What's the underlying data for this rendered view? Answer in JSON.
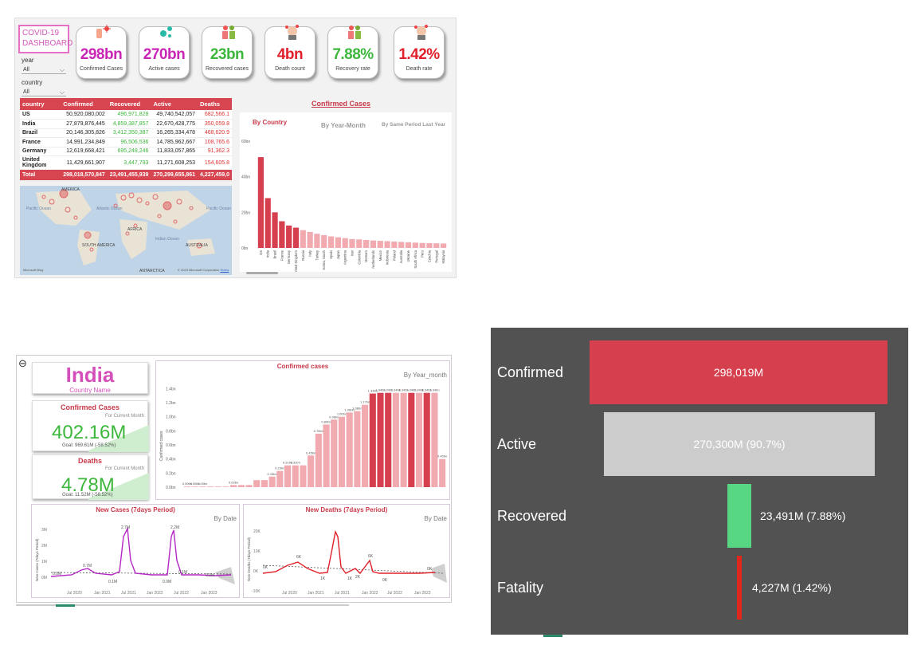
{
  "dashboard": {
    "title_line1": "COVID-19",
    "title_line2": "DASHBOARD",
    "slicers": [
      {
        "label": "year",
        "value": "All"
      },
      {
        "label": "country",
        "value": "All"
      }
    ],
    "kpis": [
      {
        "value": "298bn",
        "label": "Confirmed Cases",
        "color": "#c926b6"
      },
      {
        "value": "270bn",
        "label": "Active cases",
        "color": "#c926b6"
      },
      {
        "value": "23bn",
        "label": "Recovered cases",
        "color": "#3cb73c"
      },
      {
        "value": "4bn",
        "label": "Death count",
        "color": "#e0202a"
      },
      {
        "value": "7.88%",
        "label": "Recovery rate",
        "color": "#3cb73c"
      },
      {
        "value": "1.42%",
        "label": "Death rate",
        "color": "#e0202a"
      }
    ],
    "table": {
      "headers": [
        "country",
        "Confirmed",
        "Recovered",
        "Active",
        "Deaths"
      ],
      "rows": [
        [
          "US",
          "50,920,080,002",
          "496,971,828",
          "49,740,542,057",
          "682,566.1"
        ],
        [
          "India",
          "27,879,876,445",
          "4,859,387,857",
          "22,670,428,775",
          "350,059.8"
        ],
        [
          "Brazil",
          "20,146,305,826",
          "3,412,350,387",
          "16,265,334,478",
          "468,620.9"
        ],
        [
          "France",
          "14,991,234,849",
          "96,506,536",
          "14,785,962,667",
          "108,765.6"
        ],
        [
          "Germany",
          "12,619,668,421",
          "695,248,246",
          "11,833,057,865",
          "91,362.3"
        ],
        [
          "United Kingdom",
          "11,429,661,907",
          "3,447,793",
          "11,271,608,253",
          "154,605.8"
        ]
      ],
      "total": [
        "Total",
        "298,018,570,847",
        "23,491,455,939",
        "270,299,655,861",
        "4,227,459,0"
      ]
    },
    "map": {
      "labels": [
        "AMERICA",
        "Pacific Ocean",
        "Atlantic Ocean",
        "AFRICA",
        "Indian Ocean",
        "AUSTRALIA",
        "Pacific Ocean",
        "SOUTH AMERICA",
        "ANTARCTICA"
      ],
      "attribution": "© 2023 Microsoft Corporation",
      "terms": "Terms",
      "brand": "Microsoft Bing"
    },
    "chart_title": "Confirmed Cases",
    "chart_tabs": [
      "By Country",
      "By Year-Month",
      "By Same Period Last Year"
    ],
    "chart_data": {
      "type": "bar",
      "categories": [
        "US",
        "India",
        "Brazil",
        "France",
        "Germany",
        "United Kingdom",
        "Russia",
        "Italy",
        "Turkey",
        "Korea, South",
        "Spain",
        "Japan",
        "Argentina",
        "Iran",
        "Colombia",
        "Vietnam",
        "Netherlands",
        "Mexico",
        "Indonesia",
        "Poland",
        "Australia",
        "Ukraine",
        "South Africa",
        "Peru",
        "Czechia",
        "Portugal",
        "Malaysia"
      ],
      "values": [
        51,
        28,
        20,
        15,
        12.6,
        11.4,
        10,
        9,
        8,
        7.2,
        6.5,
        6,
        5.5,
        5,
        4.8,
        4.5,
        4.2,
        4,
        3.8,
        3.6,
        3.4,
        3.2,
        3,
        2.8,
        2.7,
        2.6,
        2.5
      ],
      "ylim": [
        0,
        60
      ],
      "yticks": [
        "0bn",
        "20bn",
        "40bn",
        "60bn"
      ],
      "highlight_count": 6
    }
  },
  "country_page": {
    "country": "India",
    "country_label": "Country Name",
    "confirmed": {
      "title": "Confirmed Cases",
      "sub": "For Current Month",
      "value": "402.16M",
      "goal": "Goal: 969.61M (-58.52%)"
    },
    "deaths": {
      "title": "Deaths",
      "sub": "For Current Month",
      "value": "4.78M",
      "goal": "Goal: 11.52M (-58.52%)"
    },
    "cases_chart": {
      "title": "Confirmed cases",
      "subtitle": "By Year_month",
      "ylabel": "Confirmed cases",
      "yticks": [
        "0.0bn",
        "0.2bn",
        "0.4bn",
        "0.6bn",
        "0.8bn",
        "1.0bn",
        "1.2bn",
        "1.4bn"
      ],
      "chart_data": {
        "type": "bar",
        "values": [
          0.0,
          0.0,
          0.0,
          0.0,
          0.0,
          0.0,
          0.03,
          0.03,
          0.03,
          0.1,
          0.1,
          0.15,
          0.23,
          0.31,
          0.31,
          0.31,
          0.45,
          0.76,
          0.89,
          0.96,
          1.0,
          1.06,
          1.08,
          1.17,
          1.33,
          1.34,
          1.34,
          1.34,
          1.34,
          1.34,
          1.34,
          1.34,
          1.34,
          0.4
        ],
        "labels": [
          "0.00bn",
          "0.00bn",
          "0.00bn",
          "",
          "",
          "",
          "0.03bn",
          "",
          "",
          "",
          "",
          "0.15bn",
          "0.23bn",
          "0.31bn",
          "0.31bn",
          "",
          "0.45bn",
          "0.76bn",
          "0.89bn",
          "0.96bn",
          "1.00bn",
          "1.06bn",
          "1.08bn",
          "1.17bn",
          "1.33bn",
          "1.34bn",
          "1.34bn",
          "1.34bn",
          "1.34bn",
          "1.34bn",
          "1.34bn",
          "1.34bn",
          "1.34bn",
          "0.40bn"
        ],
        "ylim": [
          0,
          1.4
        ]
      }
    },
    "new_cases": {
      "title": "New Cases (7days Period)",
      "subtitle": "By Date",
      "ylabel": "New Cases (7days Period)",
      "yticks": [
        "0M",
        "1M",
        "2M",
        "3M"
      ],
      "xticks": [
        "Jul 2020",
        "Jan 2021",
        "Jul 2021",
        "Jan 2022",
        "Jul 2022",
        "Jan 2023"
      ],
      "annotations": [
        "0.0M",
        "0.7M",
        "2.7M",
        "0.1M",
        "2.2M",
        "0.0M",
        "0.1M",
        "0.0M"
      ]
    },
    "new_deaths": {
      "title": "New Deaths (7days Period)",
      "subtitle": "By Date",
      "ylabel": "New Deaths (7days Period)",
      "yticks": [
        "-10K",
        "0K",
        "10K",
        "20K"
      ],
      "xticks": [
        "Jul 2020",
        "Jan 2021",
        "Jul 2021",
        "Jan 2022",
        "Jul 2022",
        "Jan 2023"
      ],
      "annotations": [
        "0K",
        "6K",
        "1K",
        "2K",
        "6K",
        "1K",
        "0K",
        "0K"
      ]
    }
  },
  "funnel": {
    "stages": [
      {
        "label": "Confirmed",
        "value": "298,019M",
        "fraction": 1.0,
        "color": "#d6404e"
      },
      {
        "label": "Active",
        "value": "270,300M (90.7%)",
        "fraction": 0.907,
        "color": "#cccccc"
      },
      {
        "label": "Recovered",
        "value": "23,491M (7.88%)",
        "fraction": 0.0788,
        "color": "#57d683"
      },
      {
        "label": "Fatality",
        "value": "4,227M (1.42%)",
        "fraction": 0.0142,
        "color": "#e0271c"
      }
    ]
  }
}
